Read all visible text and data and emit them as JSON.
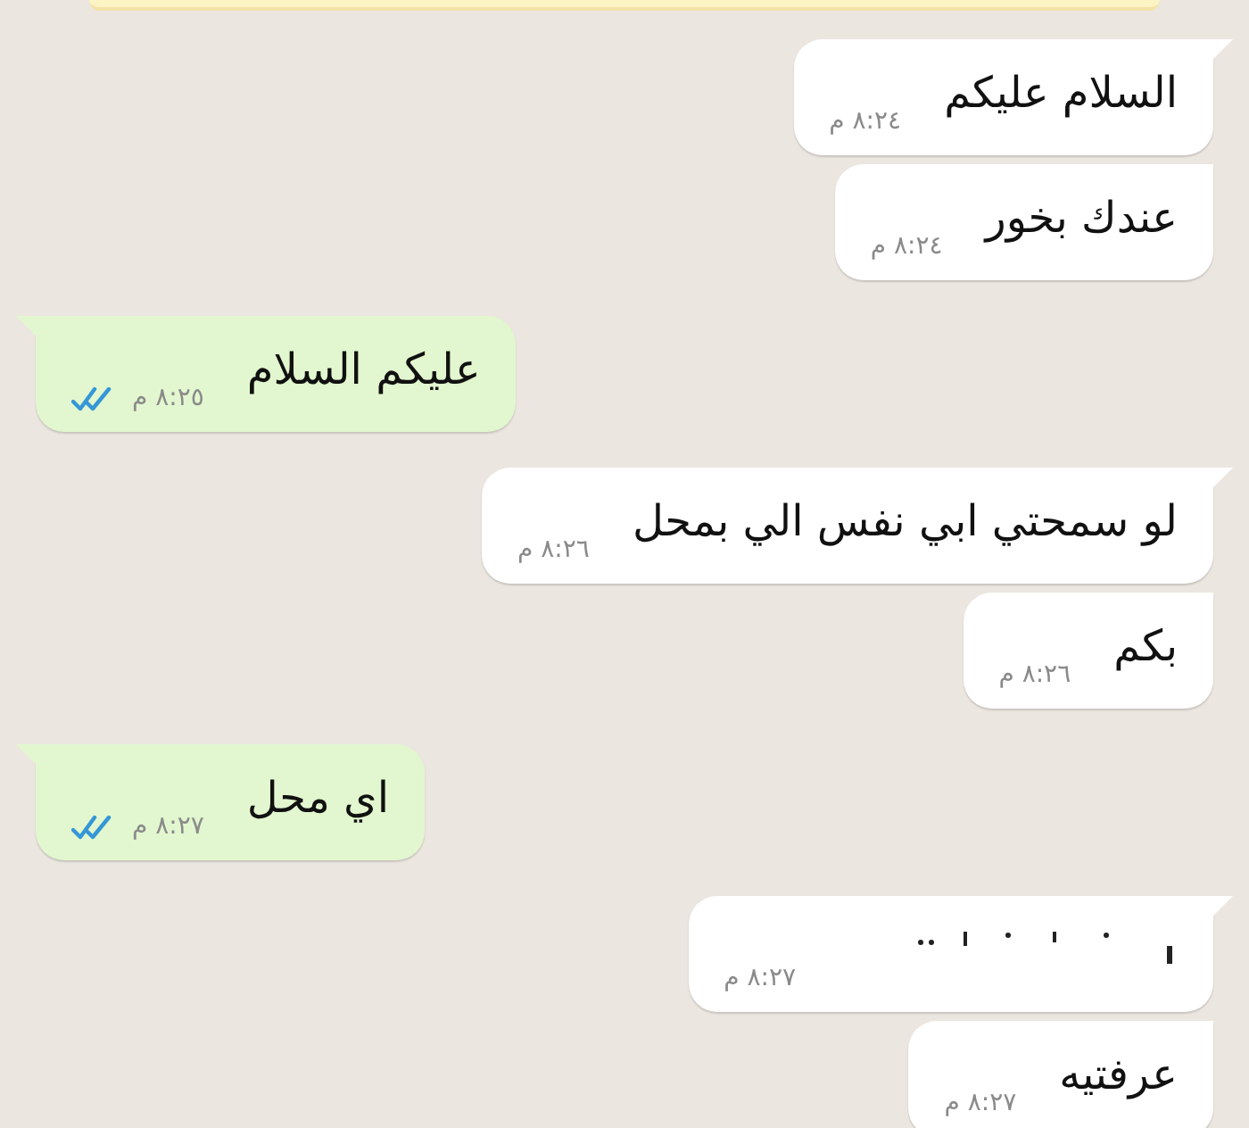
{
  "notice": {
    "kind": "banner"
  },
  "messages": [
    {
      "kind": "received",
      "tail": true,
      "text": "السلام عليكم",
      "time": "٨:٢٤ م"
    },
    {
      "kind": "received",
      "tail": false,
      "text": "عندك بخور",
      "time": "٨:٢٤ م"
    },
    {
      "kind": "sent",
      "tail": true,
      "text": "عليكم السلام",
      "time": "٨:٢٥ م",
      "read": true
    },
    {
      "kind": "received",
      "tail": true,
      "text": "لو سمحتي ابي نفس الي بمحل",
      "time": "٨:٢٦ م"
    },
    {
      "kind": "received",
      "tail": false,
      "text": "بكم",
      "time": "٨:٢٦ م"
    },
    {
      "kind": "sent",
      "tail": true,
      "text": "اي محل",
      "time": "٨:٢٧ م",
      "read": true
    },
    {
      "kind": "redacted",
      "tail": true,
      "time": "٨:٢٧ م"
    },
    {
      "kind": "received",
      "tail": false,
      "text": "عرفتيه",
      "time": "٨:٢٧ م"
    }
  ]
}
